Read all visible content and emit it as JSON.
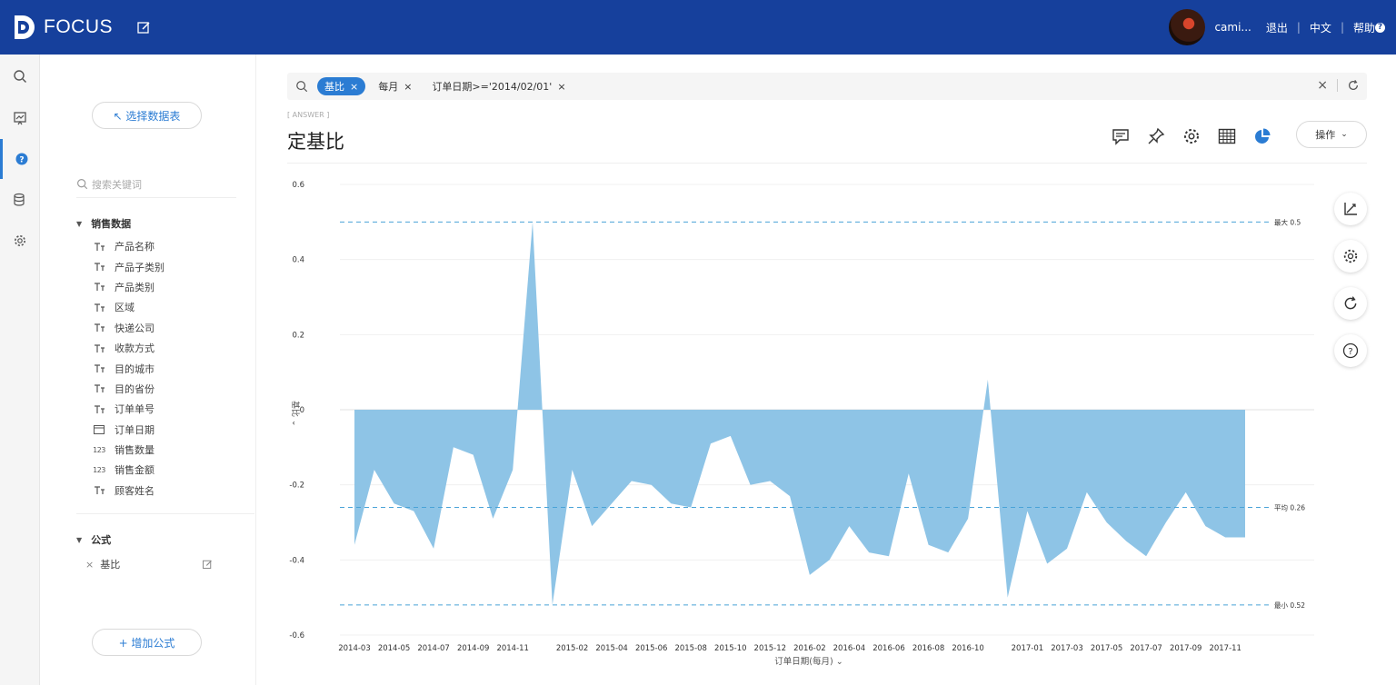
{
  "app": {
    "name": "FOCUS"
  },
  "header": {
    "username": "cami...",
    "logout": "退出",
    "language": "中文",
    "help": "帮助"
  },
  "rail": {
    "icons": [
      "search-icon",
      "dashboard-icon",
      "help-circle-icon",
      "database-icon",
      "gear-icon"
    ]
  },
  "panel": {
    "select_table": "↖ 选择数据表",
    "search_placeholder": "搜索关键词",
    "group_sales": "销售数据",
    "fields": [
      {
        "label": "产品名称",
        "type": "text"
      },
      {
        "label": "产品子类别",
        "type": "text"
      },
      {
        "label": "产品类别",
        "type": "text"
      },
      {
        "label": "区域",
        "type": "text"
      },
      {
        "label": "快递公司",
        "type": "text"
      },
      {
        "label": "收款方式",
        "type": "text"
      },
      {
        "label": "目的城市",
        "type": "text"
      },
      {
        "label": "目的省份",
        "type": "text"
      },
      {
        "label": "订单单号",
        "type": "text"
      },
      {
        "label": "订单日期",
        "type": "date"
      },
      {
        "label": "销售数量",
        "type": "number"
      },
      {
        "label": "销售金额",
        "type": "number"
      },
      {
        "label": "顾客姓名",
        "type": "text"
      }
    ],
    "group_formula": "公式",
    "formula_item": "基比",
    "add_formula": "+ 增加公式"
  },
  "searchbar": {
    "tokens": [
      {
        "label": "基比",
        "style": "blue"
      },
      {
        "label": "每月",
        "style": "plain"
      },
      {
        "label": "订单日期>='2014/02/01'",
        "style": "plain"
      }
    ]
  },
  "answer": {
    "label": "[ ANSWER ]",
    "title": "定基比",
    "operate": "操作"
  },
  "chart_data": {
    "type": "area",
    "color": "#8ec4e6",
    "xlabel": "订单日期(每月)",
    "ylabel": "基比",
    "ylim": [
      -0.6,
      0.6
    ],
    "yticks": [
      "0.6",
      "0.4",
      "0.2",
      "0",
      "-0.2",
      "-0.4",
      "-0.6"
    ],
    "x": [
      "2014-03",
      "2014-04",
      "2014-05",
      "2014-06",
      "2014-07",
      "2014-08",
      "2014-09",
      "2014-10",
      "2014-11",
      "2014-12",
      "2015-01",
      "2015-02",
      "2015-03",
      "2015-04",
      "2015-05",
      "2015-06",
      "2015-07",
      "2015-08",
      "2015-09",
      "2015-10",
      "2015-11",
      "2015-12",
      "2016-01",
      "2016-02",
      "2016-03",
      "2016-04",
      "2016-05",
      "2016-06",
      "2016-07",
      "2016-08",
      "2016-09",
      "2016-10",
      "2016-11",
      "2016-12",
      "2017-01",
      "2017-02",
      "2017-03",
      "2017-04",
      "2017-05",
      "2017-06",
      "2017-07",
      "2017-08",
      "2017-09",
      "2017-10",
      "2017-11",
      "2017-12"
    ],
    "xtick_labels": [
      "2014-03",
      "2014-05",
      "2014-07",
      "2014-09",
      "2014-11",
      "2015-02",
      "2015-04",
      "2015-06",
      "2015-08",
      "2015-10",
      "2015-12",
      "2016-02",
      "2016-04",
      "2016-06",
      "2016-08",
      "2016-10",
      "2017-01",
      "2017-03",
      "2017-05",
      "2017-07",
      "2017-09",
      "2017-11"
    ],
    "values": [
      -0.36,
      -0.16,
      -0.25,
      -0.27,
      -0.37,
      -0.1,
      -0.12,
      -0.29,
      -0.16,
      0.5,
      -0.52,
      -0.16,
      -0.31,
      -0.25,
      -0.19,
      -0.2,
      -0.25,
      -0.26,
      -0.09,
      -0.07,
      -0.2,
      -0.19,
      -0.23,
      -0.44,
      -0.4,
      -0.31,
      -0.38,
      -0.39,
      -0.17,
      -0.36,
      -0.38,
      -0.29,
      0.08,
      -0.5,
      -0.27,
      -0.41,
      -0.37,
      -0.22,
      -0.3,
      -0.35,
      -0.39,
      -0.3,
      -0.22,
      -0.31,
      -0.34,
      -0.34
    ],
    "ref_lines": [
      {
        "label": "最大 0.5",
        "value": 0.5
      },
      {
        "label": "平均 0.26",
        "value": -0.26
      },
      {
        "label": "最小 0.52",
        "value": -0.52
      }
    ]
  }
}
